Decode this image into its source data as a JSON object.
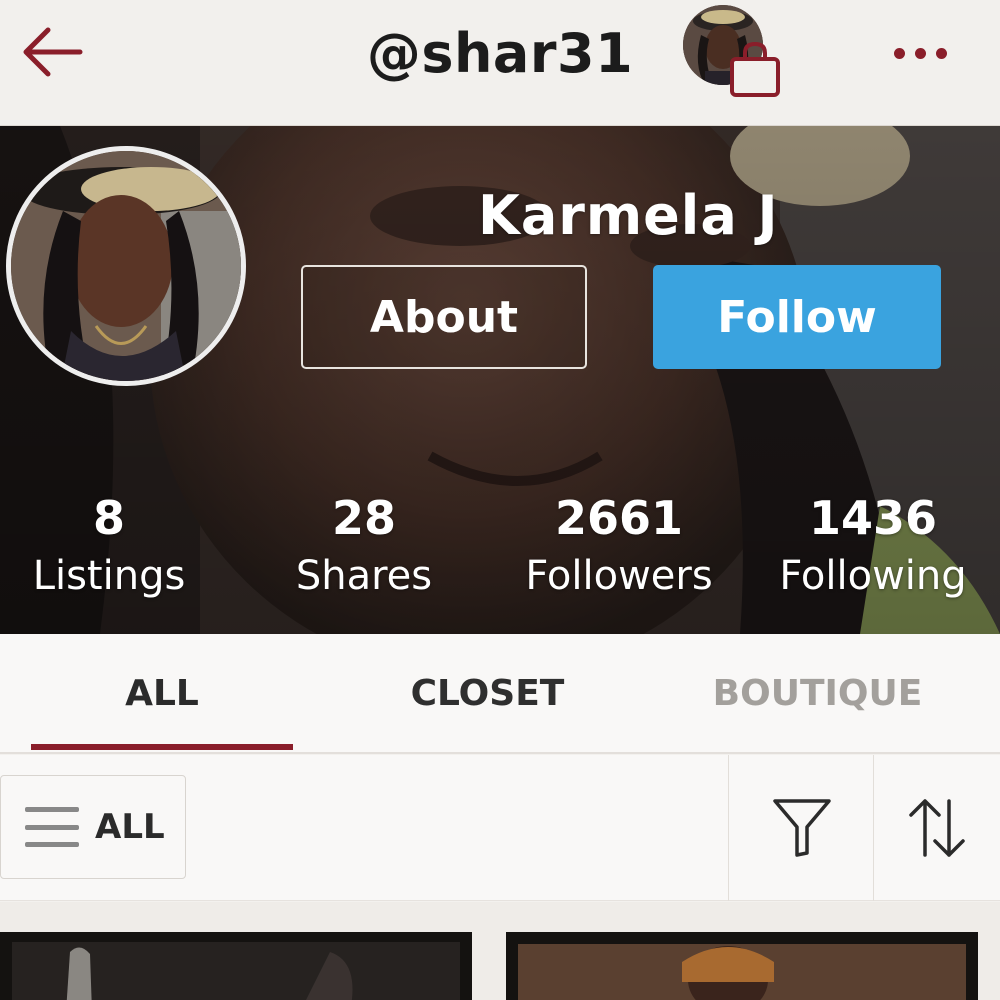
{
  "header": {
    "title": "@shar31",
    "back_icon": "back-arrow-icon",
    "bag_icon": "shopping-bag-icon",
    "more_icon": "more-dots-icon"
  },
  "profile": {
    "display_name": "Karmela J",
    "about_label": "About",
    "follow_label": "Follow",
    "stats": [
      {
        "value": "8",
        "label": "Listings"
      },
      {
        "value": "28",
        "label": "Shares"
      },
      {
        "value": "2661",
        "label": "Followers"
      },
      {
        "value": "1436",
        "label": "Following"
      }
    ]
  },
  "tabs": [
    {
      "label": "ALL",
      "active": true
    },
    {
      "label": "CLOSET",
      "active": false
    },
    {
      "label": "BOUTIQUE",
      "active": false
    }
  ],
  "filters": {
    "category_label": "ALL",
    "filter_icon": "funnel-icon",
    "sort_icon": "sort-arrows-icon"
  },
  "colors": {
    "accent": "#8a1e2a",
    "follow": "#3aa3df",
    "background": "#f3f1ee"
  }
}
